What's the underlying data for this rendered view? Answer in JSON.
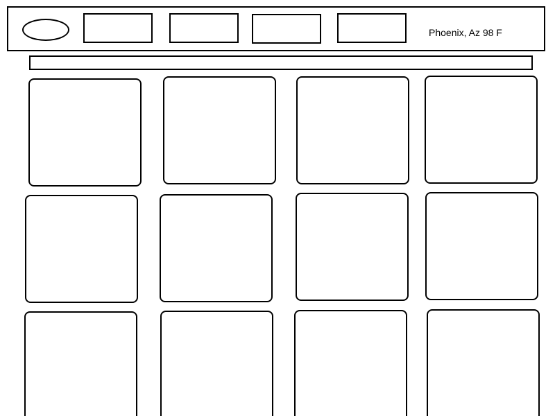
{
  "header": {
    "weather_text": "Phoenix, Az 98 F",
    "nav_items": [
      "",
      "",
      "",
      ""
    ]
  },
  "banner": {
    "text": ""
  },
  "grid": {
    "rows": 3,
    "columns": 4,
    "tiles": [
      "",
      "",
      "",
      "",
      "",
      "",
      "",
      "",
      "",
      "",
      "",
      ""
    ]
  }
}
